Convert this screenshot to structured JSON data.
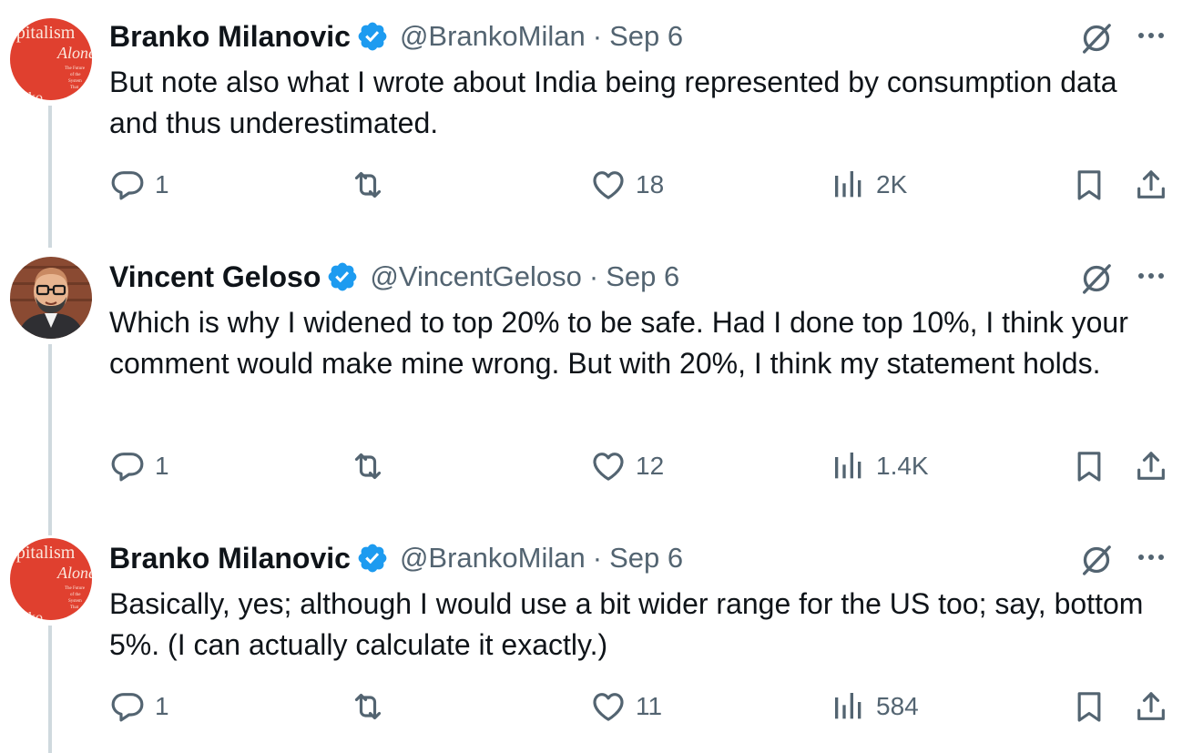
{
  "tweets": [
    {
      "name": "Branko Milanovic",
      "handle": "@BrankoMilan",
      "dot": "·",
      "date": "Sep 6",
      "text": "But note also what I wrote about India being represented by consumption data and thus underestimated.",
      "replies": "1",
      "likes": "18",
      "views": "2K",
      "avatar": "book-cover-avatar"
    },
    {
      "name": "Vincent Geloso",
      "handle": "@VincentGeloso",
      "dot": "·",
      "date": "Sep 6",
      "text": "Which is why I widened to top 20% to be safe. Had I done top 10%, I think your comment would make mine wrong. But with 20%, I think my statement holds.",
      "replies": "1",
      "likes": "12",
      "views": "1.4K",
      "avatar": "cartoon-portrait-avatar"
    },
    {
      "name": "Branko Milanovic",
      "handle": "@BrankoMilan",
      "dot": "·",
      "date": "Sep 6",
      "text": "Basically, yes; although I would use a bit wider range for the US too; say, bottom 5%. (I can actually calculate it exactly.)",
      "replies": "1",
      "likes": "11",
      "views": "584",
      "avatar": "book-cover-avatar"
    }
  ],
  "colors": {
    "text": "#0f1419",
    "secondary": "#536471",
    "verified": "#1d9bf0",
    "thread_line": "#cfd9de",
    "book_red": "#e0402f"
  },
  "icons": [
    "verified-badge-icon",
    "grok-icon",
    "more-icon",
    "reply-icon",
    "retweet-icon",
    "like-icon",
    "views-icon",
    "bookmark-icon",
    "share-icon"
  ]
}
